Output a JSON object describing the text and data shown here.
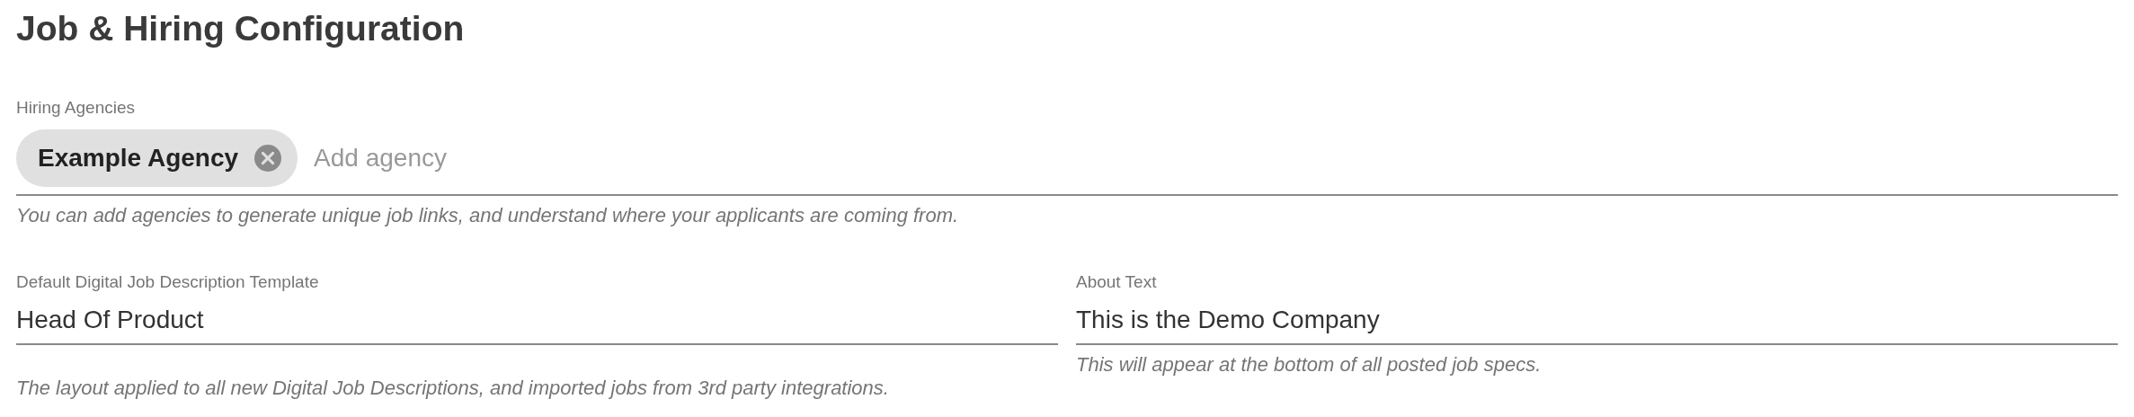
{
  "title": "Job & Hiring Configuration",
  "agencies": {
    "label": "Hiring Agencies",
    "chips": [
      {
        "text": "Example Agency"
      }
    ],
    "placeholder": "Add agency",
    "hint": "You can add agencies to generate unique job links, and understand where your applicants are coming from."
  },
  "fields": [
    {
      "label": "Default Digital Job Description Template",
      "value": "Head Of Product",
      "hint": "The layout applied to all new Digital Job Descriptions, and imported jobs from 3rd party integrations."
    },
    {
      "label": "About Text",
      "value": "This is the Demo Company",
      "hint": "This will appear at the bottom of all posted job specs."
    }
  ]
}
